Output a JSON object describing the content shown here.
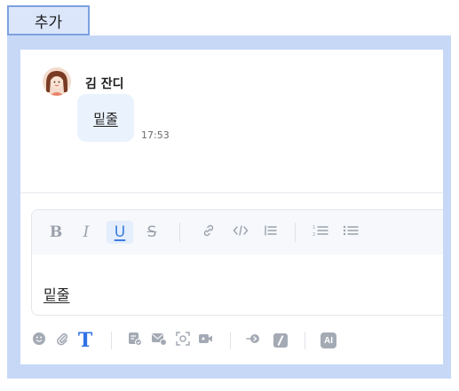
{
  "header": {
    "tag_label": "추가"
  },
  "message": {
    "sender_name": "김 잔디",
    "text": "밑줄",
    "time": "17:53"
  },
  "editor": {
    "content": "밑줄",
    "toolbar": {
      "bold_label": "B",
      "italic_label": "I",
      "underline_label": "U",
      "strike_label": "S",
      "active_format": "underline"
    }
  },
  "bottom_toolbar": {
    "ai_label": "AI"
  },
  "colors": {
    "frame_bg": "#c7d8f7",
    "accent": "#3f7de0",
    "bubble_bg": "#eaf3fd"
  }
}
